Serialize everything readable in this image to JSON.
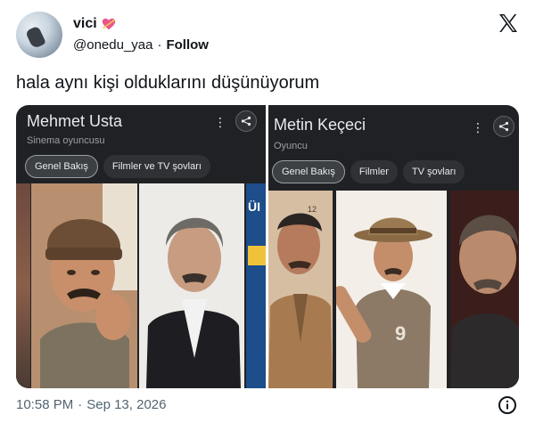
{
  "author": {
    "display_name": "vici",
    "name_emoji": "💘",
    "handle": "@onedu_yaa",
    "separator": "·",
    "follow_label": "Follow"
  },
  "tweet": {
    "text": "hala aynı kişi olduklarını düşünüyorum",
    "time": "10:58 PM",
    "separator": "·",
    "date": "Sep 13, 2026"
  },
  "media": {
    "left": {
      "title": "Mehmet Usta",
      "subtitle": "Sinema oyuncusu",
      "chips": [
        "Genel Bakış",
        "Filmler ve TV şovları"
      ],
      "overlay_text": "ÜI"
    },
    "right": {
      "title": "Metin Keçeci",
      "subtitle": "Oyuncu",
      "chips": [
        "Genel Bakış",
        "Filmler",
        "TV şovları"
      ],
      "overlay_text": "12"
    }
  },
  "icons": {
    "verified_heart": "heart-with-arrow-icon",
    "brand": "x-logo-icon",
    "info": "info-icon",
    "share": "share-icon",
    "more": "more-vert-icon"
  }
}
